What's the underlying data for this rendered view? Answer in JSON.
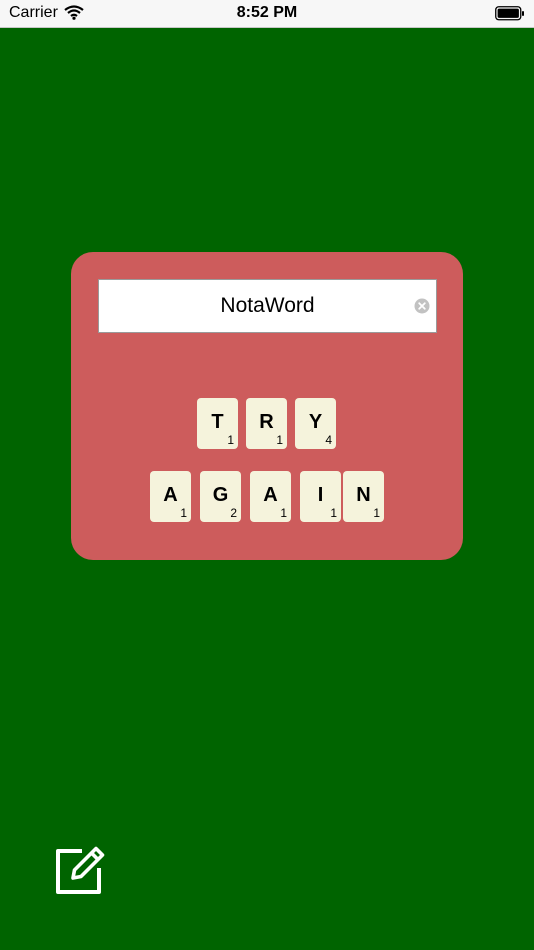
{
  "status_bar": {
    "carrier": "Carrier",
    "time": "8:52 PM"
  },
  "word_field": {
    "value": "NotaWord",
    "clear_icon": "clear-circle-icon"
  },
  "rows": [
    {
      "tiles": [
        {
          "letter": "T",
          "points": "1"
        },
        {
          "letter": "R",
          "points": "1"
        },
        {
          "letter": "Y",
          "points": "4"
        }
      ]
    },
    {
      "tiles": [
        {
          "letter": "A",
          "points": "1"
        },
        {
          "letter": "G",
          "points": "2"
        },
        {
          "letter": "A",
          "points": "1"
        },
        {
          "letter": "I",
          "points": "1"
        },
        {
          "letter": "N",
          "points": "1"
        }
      ]
    }
  ],
  "footer": {
    "edit_icon": "compose-icon"
  },
  "colors": {
    "background": "#006400",
    "card": "#cd5c5c",
    "tile": "#f5f3dc"
  }
}
